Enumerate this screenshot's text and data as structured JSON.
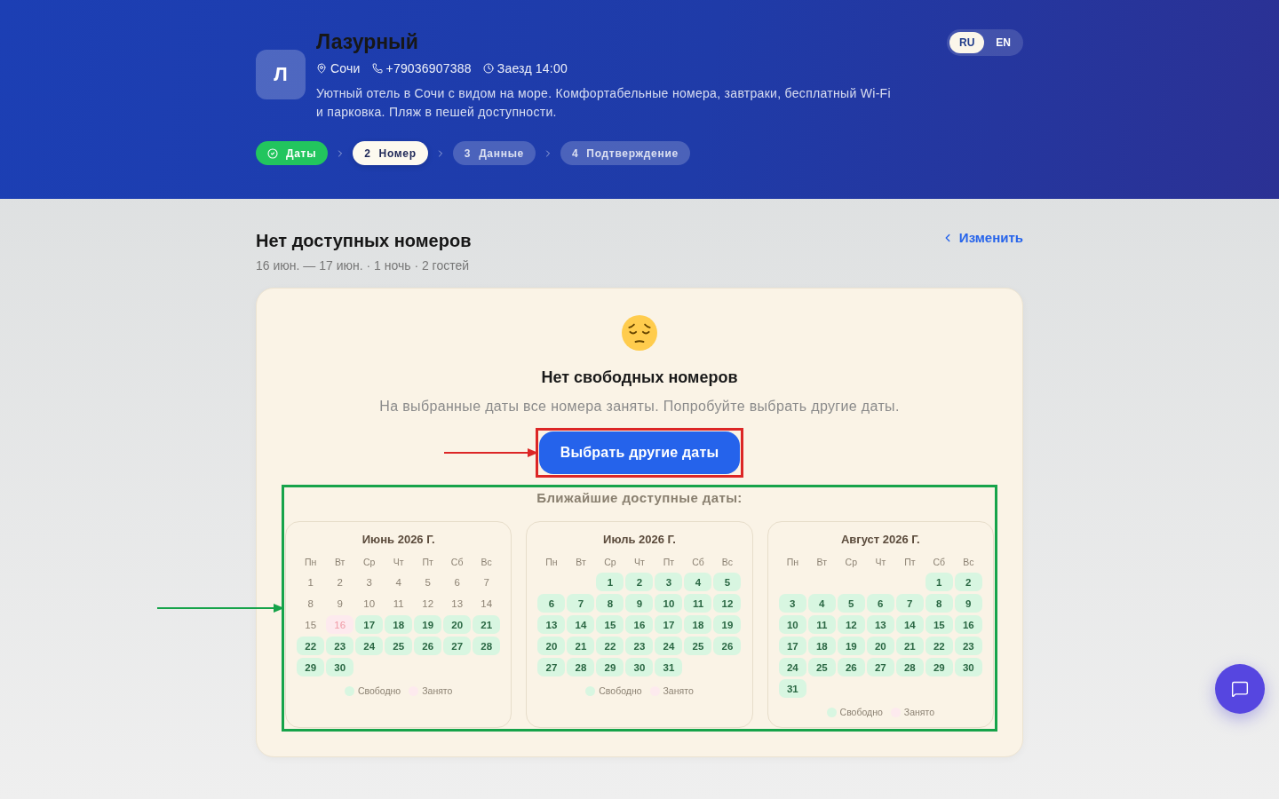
{
  "header": {
    "logo_letter": "Л",
    "title": "Лазурный",
    "meta": [
      {
        "kind": "location",
        "text": "Сочи"
      },
      {
        "kind": "phone",
        "text": "+79036907388"
      },
      {
        "kind": "checkin",
        "text": "Заезд 14:00"
      }
    ],
    "description": "Уютный отель в Сочи с видом на море. Комфортабельные номера, завтраки, бесплатный Wi-Fi и парковка. Пляж в пешей доступности.",
    "languages": [
      {
        "label": "RU",
        "selected": true
      },
      {
        "label": "EN",
        "selected": false
      }
    ],
    "steps": [
      {
        "label": "Даты",
        "done": true,
        "selected": false
      },
      {
        "number": "2",
        "label": "Номер",
        "done": false,
        "selected": true
      },
      {
        "number": "3",
        "label": "Данные",
        "done": false,
        "selected": false
      },
      {
        "number": "4",
        "label": "Подтверждение",
        "done": false,
        "selected": false
      }
    ]
  },
  "section": {
    "title": "Нет доступных номеров",
    "subtitle": "16 июн. — 17 июн. · 1 ночь · 2 гостей",
    "change_link": "Изменить"
  },
  "empty_state": {
    "title": "Нет свободных номеров",
    "text": "На выбранные даты все номера заняты. Попробуйте выбрать другие даты.",
    "button": {
      "label": "Выбрать другие даты",
      "highlight": {
        "color": "#dc2626"
      }
    }
  },
  "nearby": {
    "title": "Ближайшие доступные даты:",
    "highlight": {
      "color": "#16a34a"
    },
    "calendars": [
      {
        "month": "Июнь 2026 Г.",
        "weekdays": [
          "Пн",
          "Вт",
          "Ср",
          "Чт",
          "Пт",
          "Сб",
          "Вс"
        ],
        "days": [
          {
            "day": "1",
            "kind": "past"
          },
          {
            "day": "2",
            "kind": "past"
          },
          {
            "day": "3",
            "kind": "past"
          },
          {
            "day": "4",
            "kind": "past"
          },
          {
            "day": "5",
            "kind": "past"
          },
          {
            "day": "6",
            "kind": "past"
          },
          {
            "day": "7",
            "kind": "past"
          },
          {
            "day": "8",
            "kind": "past"
          },
          {
            "day": "9",
            "kind": "past"
          },
          {
            "day": "10",
            "kind": "past"
          },
          {
            "day": "11",
            "kind": "past"
          },
          {
            "day": "12",
            "kind": "past"
          },
          {
            "day": "13",
            "kind": "past"
          },
          {
            "day": "14",
            "kind": "past"
          },
          {
            "day": "15",
            "kind": "past"
          },
          {
            "day": "16",
            "kind": "busy"
          },
          {
            "day": "17",
            "kind": "free"
          },
          {
            "day": "18",
            "kind": "free"
          },
          {
            "day": "19",
            "kind": "free"
          },
          {
            "day": "20",
            "kind": "free"
          },
          {
            "day": "21",
            "kind": "free"
          },
          {
            "day": "22",
            "kind": "free"
          },
          {
            "day": "23",
            "kind": "free"
          },
          {
            "day": "24",
            "kind": "free"
          },
          {
            "day": "25",
            "kind": "free"
          },
          {
            "day": "26",
            "kind": "free"
          },
          {
            "day": "27",
            "kind": "free"
          },
          {
            "day": "28",
            "kind": "free"
          },
          {
            "day": "29",
            "kind": "free"
          },
          {
            "day": "30",
            "kind": "free"
          }
        ],
        "legend": [
          {
            "kind": "free",
            "label": "Свободно"
          },
          {
            "kind": "busy",
            "label": "Занято"
          }
        ]
      },
      {
        "month": "Июль 2026 Г.",
        "weekdays": [
          "Пн",
          "Вт",
          "Ср",
          "Чт",
          "Пт",
          "Сб",
          "Вс"
        ],
        "days": [
          {
            "kind": "blank"
          },
          {
            "kind": "blank"
          },
          {
            "day": "1",
            "kind": "free"
          },
          {
            "day": "2",
            "kind": "free"
          },
          {
            "day": "3",
            "kind": "free"
          },
          {
            "day": "4",
            "kind": "free"
          },
          {
            "day": "5",
            "kind": "free"
          },
          {
            "day": "6",
            "kind": "free"
          },
          {
            "day": "7",
            "kind": "free"
          },
          {
            "day": "8",
            "kind": "free"
          },
          {
            "day": "9",
            "kind": "free"
          },
          {
            "day": "10",
            "kind": "free"
          },
          {
            "day": "11",
            "kind": "free"
          },
          {
            "day": "12",
            "kind": "free"
          },
          {
            "day": "13",
            "kind": "free"
          },
          {
            "day": "14",
            "kind": "free"
          },
          {
            "day": "15",
            "kind": "free"
          },
          {
            "day": "16",
            "kind": "free"
          },
          {
            "day": "17",
            "kind": "free"
          },
          {
            "day": "18",
            "kind": "free"
          },
          {
            "day": "19",
            "kind": "free"
          },
          {
            "day": "20",
            "kind": "free"
          },
          {
            "day": "21",
            "kind": "free"
          },
          {
            "day": "22",
            "kind": "free"
          },
          {
            "day": "23",
            "kind": "free"
          },
          {
            "day": "24",
            "kind": "free"
          },
          {
            "day": "25",
            "kind": "free"
          },
          {
            "day": "26",
            "kind": "free"
          },
          {
            "day": "27",
            "kind": "free"
          },
          {
            "day": "28",
            "kind": "free"
          },
          {
            "day": "29",
            "kind": "free"
          },
          {
            "day": "30",
            "kind": "free"
          },
          {
            "day": "31",
            "kind": "free"
          }
        ],
        "legend": [
          {
            "kind": "free",
            "label": "Свободно"
          },
          {
            "kind": "busy",
            "label": "Занято"
          }
        ]
      },
      {
        "month": "Август 2026 Г.",
        "weekdays": [
          "Пн",
          "Вт",
          "Ср",
          "Чт",
          "Пт",
          "Сб",
          "Вс"
        ],
        "days": [
          {
            "kind": "blank"
          },
          {
            "kind": "blank"
          },
          {
            "kind": "blank"
          },
          {
            "kind": "blank"
          },
          {
            "kind": "blank"
          },
          {
            "day": "1",
            "kind": "free"
          },
          {
            "day": "2",
            "kind": "free"
          },
          {
            "day": "3",
            "kind": "free"
          },
          {
            "day": "4",
            "kind": "free"
          },
          {
            "day": "5",
            "kind": "free"
          },
          {
            "day": "6",
            "kind": "free"
          },
          {
            "day": "7",
            "kind": "free"
          },
          {
            "day": "8",
            "kind": "free"
          },
          {
            "day": "9",
            "kind": "free"
          },
          {
            "day": "10",
            "kind": "free"
          },
          {
            "day": "11",
            "kind": "free"
          },
          {
            "day": "12",
            "kind": "free"
          },
          {
            "day": "13",
            "kind": "free"
          },
          {
            "day": "14",
            "kind": "free"
          },
          {
            "day": "15",
            "kind": "free"
          },
          {
            "day": "16",
            "kind": "free"
          },
          {
            "day": "17",
            "kind": "free"
          },
          {
            "day": "18",
            "kind": "free"
          },
          {
            "day": "19",
            "kind": "free"
          },
          {
            "day": "20",
            "kind": "free"
          },
          {
            "day": "21",
            "kind": "free"
          },
          {
            "day": "22",
            "kind": "free"
          },
          {
            "day": "23",
            "kind": "free"
          },
          {
            "day": "24",
            "kind": "free"
          },
          {
            "day": "25",
            "kind": "free"
          },
          {
            "day": "26",
            "kind": "free"
          },
          {
            "day": "27",
            "kind": "free"
          },
          {
            "day": "28",
            "kind": "free"
          },
          {
            "day": "29",
            "kind": "free"
          },
          {
            "day": "30",
            "kind": "free"
          },
          {
            "day": "31",
            "kind": "free"
          }
        ],
        "legend": [
          {
            "kind": "free",
            "label": "Свободно"
          },
          {
            "kind": "busy",
            "label": "Занято"
          }
        ]
      }
    ]
  }
}
